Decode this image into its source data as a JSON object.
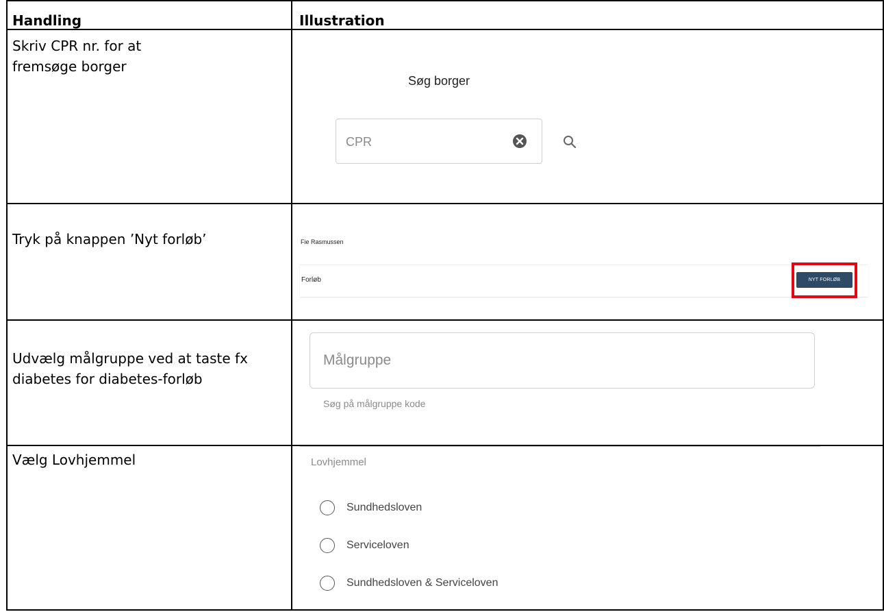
{
  "table": {
    "headers": {
      "action": "Handling",
      "illustration": "Illustration"
    },
    "rows": [
      {
        "action": "Skriv CPR nr. for at fremsøge borger"
      },
      {
        "action": "Tryk på knappen ’Nyt forløb’"
      },
      {
        "action": "Udvælg målgruppe ved at taste fx diabetes for diabetes-forløb"
      },
      {
        "action": "Vælg Lovhjemmel"
      }
    ]
  },
  "search": {
    "title": "Søg borger",
    "placeholder": "CPR",
    "clear_icon": "clear-circle-icon",
    "search_icon": "search-icon"
  },
  "citizen": {
    "name": "Fie Rasmussen",
    "section_label": "Forløb",
    "new_button": "NYT FORLØB",
    "highlight_color": "#e30613",
    "button_color": "#2e4a66"
  },
  "target_group": {
    "placeholder": "Målgruppe",
    "helper": "Søg på målgruppe kode"
  },
  "legal_basis": {
    "label": "Lovhjemmel",
    "options": [
      "Sundhedsloven",
      "Serviceloven",
      "Sundhedsloven & Serviceloven"
    ]
  }
}
